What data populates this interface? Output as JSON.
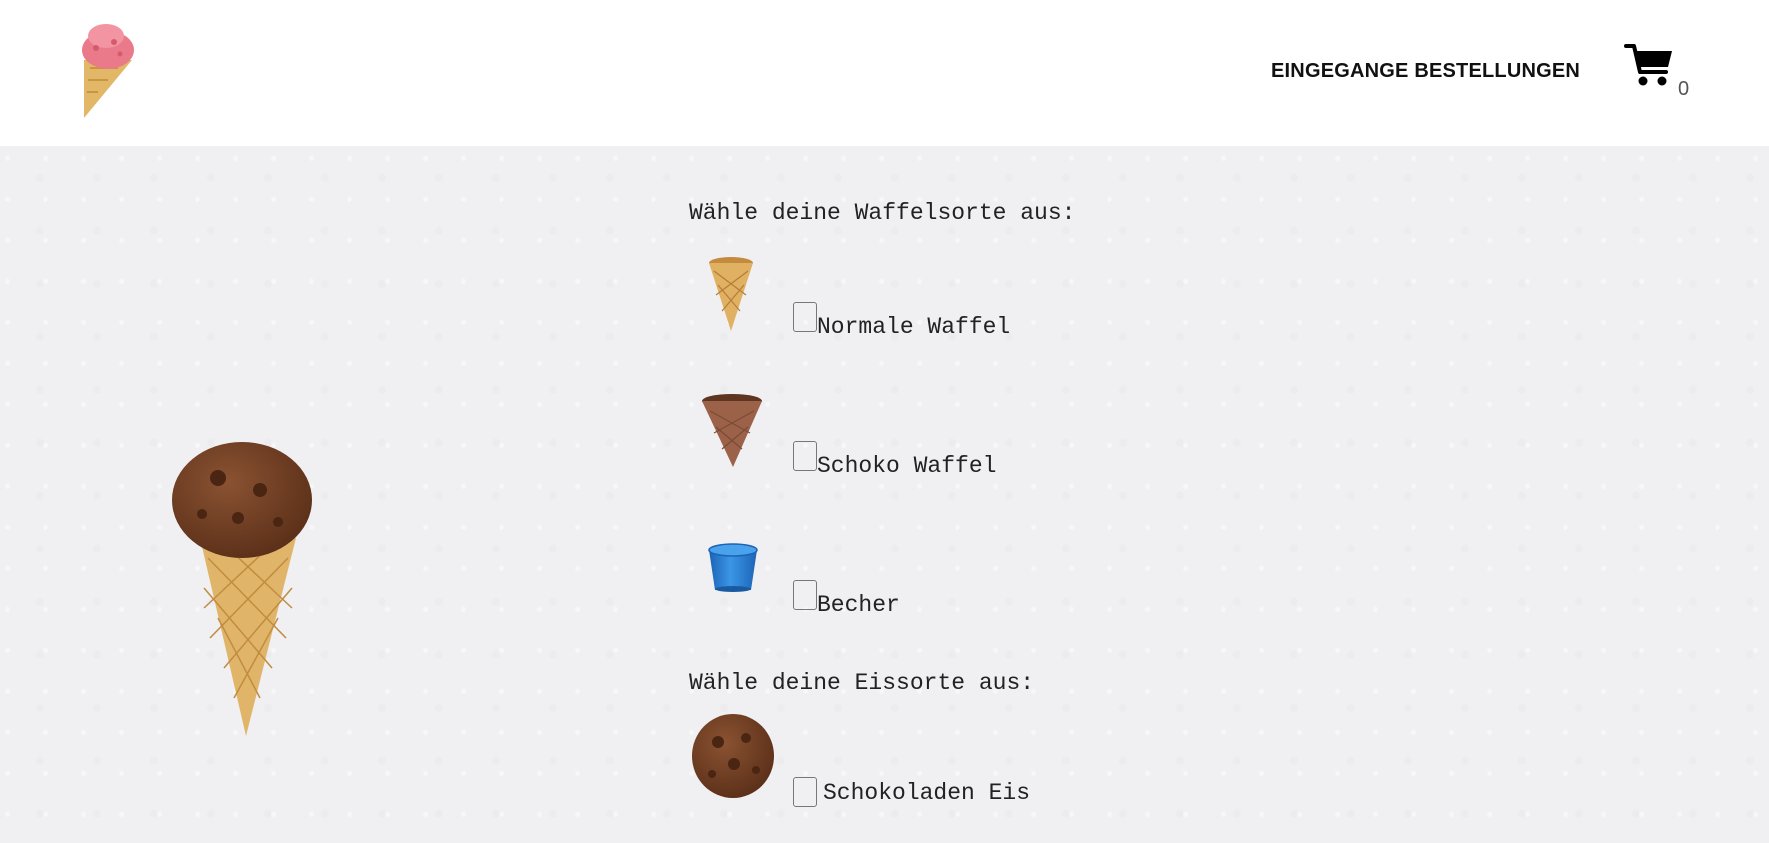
{
  "header": {
    "logo_icon": "ice-cream-cone-icon",
    "nav_link": "EINGEGANGE BESTELLUNGEN",
    "cart_icon": "shopping-cart-icon",
    "cart_count": "0"
  },
  "preview_icon": "chocolate-ice-cream-cone-image",
  "waffle_section": {
    "title": "Wähle deine Waffelsorte aus:",
    "options": [
      {
        "label": "Normale Waffel",
        "icon": "plain-waffle-cone-icon",
        "checked": false
      },
      {
        "label": "Schoko Waffel",
        "icon": "chocolate-waffle-cone-icon",
        "checked": false
      },
      {
        "label": "Becher",
        "icon": "cup-icon",
        "checked": false
      }
    ]
  },
  "ice_section": {
    "title": "Wähle deine Eissorte aus:",
    "options": [
      {
        "label": "Schokoladen Eis",
        "icon": "chocolate-scoop-icon",
        "checked": false
      }
    ]
  },
  "colors": {
    "header_bg": "#ffffff",
    "page_bg": "#f2f2f4",
    "cup_blue": "#2a7fd4",
    "chocolate": "#6e3d22",
    "waffle": "#d9a85c",
    "strawberry": "#e8707f"
  }
}
